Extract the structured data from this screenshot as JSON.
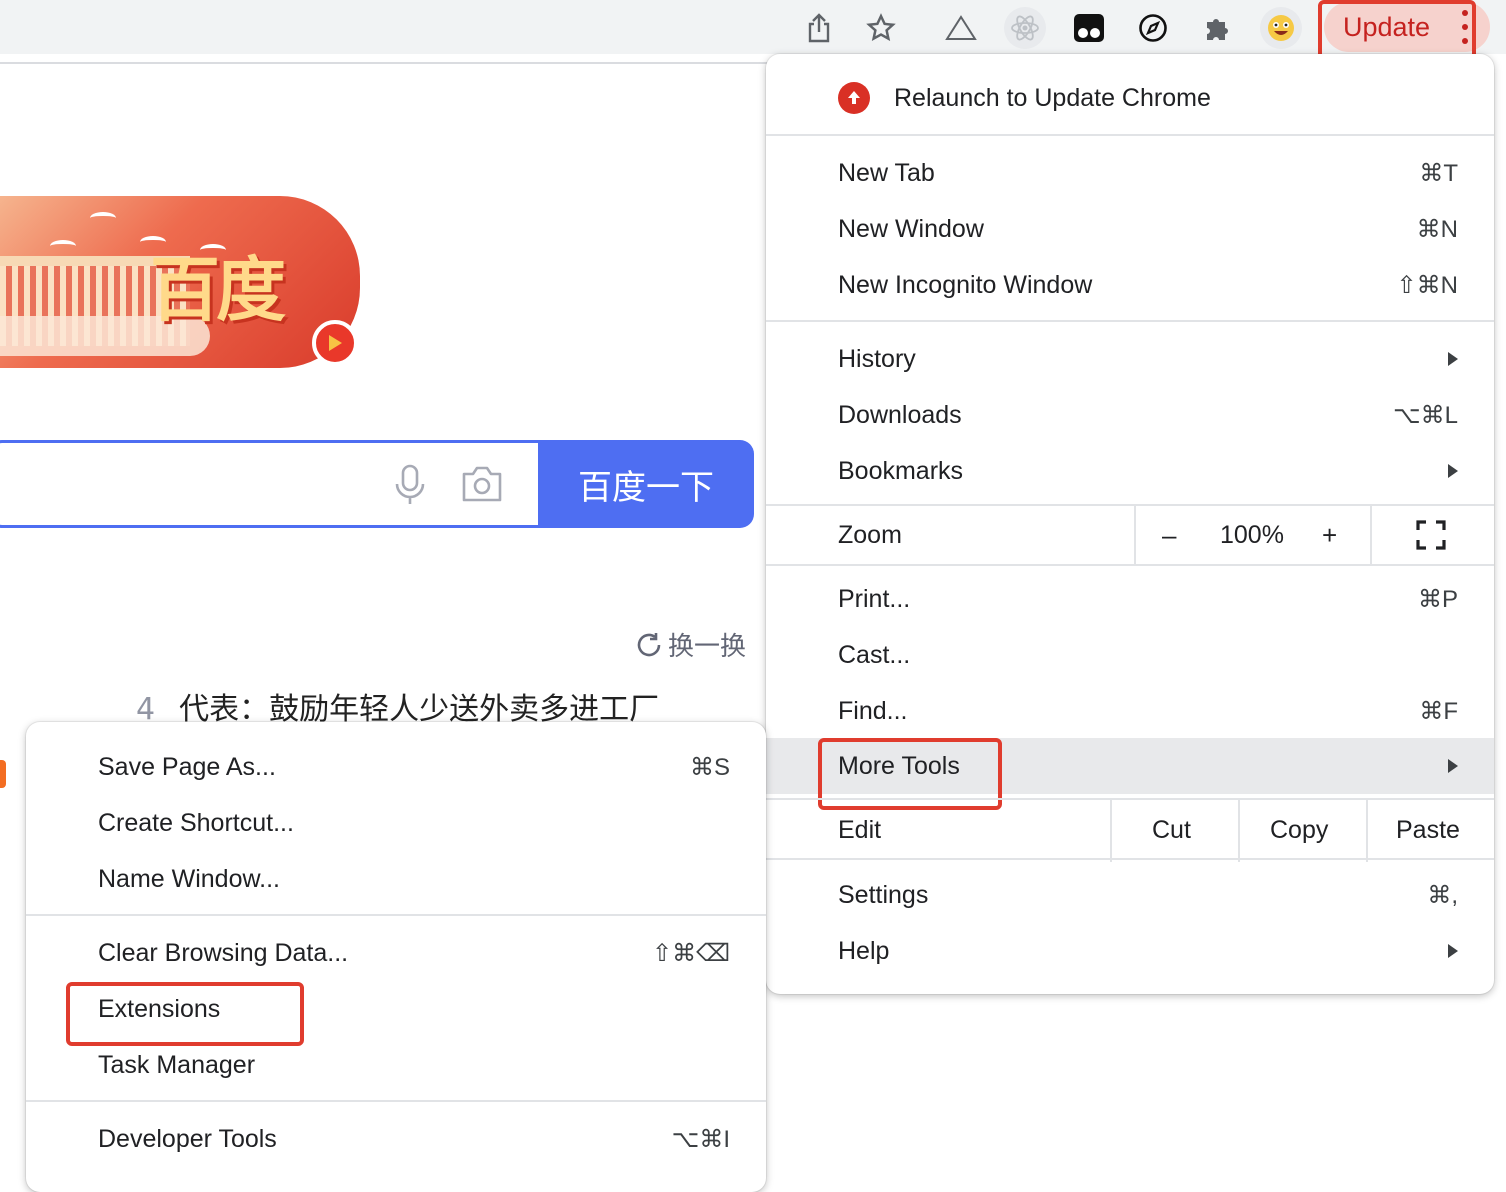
{
  "toolbar": {
    "icons": [
      "share-icon",
      "star-icon",
      "drive-icon",
      "react-devtools-icon",
      "extension-tab-icon",
      "compass-extension-icon",
      "puzzle-extensions-icon",
      "emoji-profile-icon"
    ],
    "update_label": "Update",
    "colors": {
      "update_bg": "#f6d2cd",
      "update_text": "#c5221f",
      "highlight": "#e03c2e"
    }
  },
  "page": {
    "doodle_text": "百度",
    "search_button": "百度一下",
    "refresh_link": "换一换",
    "hot_item": {
      "rank": "4",
      "text": "代表：鼓励年轻人少送外卖多进工厂"
    }
  },
  "main_menu": {
    "relaunch": "Relaunch to Update Chrome",
    "items": {
      "new_tab": {
        "label": "New Tab",
        "shortcut": "⌘T"
      },
      "new_window": {
        "label": "New Window",
        "shortcut": "⌘N"
      },
      "incognito": {
        "label": "New Incognito Window",
        "shortcut": "⇧⌘N"
      },
      "history": {
        "label": "History"
      },
      "downloads": {
        "label": "Downloads",
        "shortcut": "⌥⌘L"
      },
      "bookmarks": {
        "label": "Bookmarks"
      },
      "print": {
        "label": "Print...",
        "shortcut": "⌘P"
      },
      "cast": {
        "label": "Cast..."
      },
      "find": {
        "label": "Find...",
        "shortcut": "⌘F"
      },
      "more_tools": {
        "label": "More Tools"
      },
      "settings": {
        "label": "Settings",
        "shortcut": "⌘,"
      },
      "help": {
        "label": "Help"
      }
    },
    "zoom": {
      "label": "Zoom",
      "minus": "–",
      "value": "100%",
      "plus": "+"
    },
    "edit": {
      "label": "Edit",
      "cut": "Cut",
      "copy": "Copy",
      "paste": "Paste"
    }
  },
  "sub_menu": {
    "save_page": {
      "label": "Save Page As...",
      "shortcut": "⌘S"
    },
    "create_shortcut": {
      "label": "Create Shortcut..."
    },
    "name_window": {
      "label": "Name Window..."
    },
    "clear_data": {
      "label": "Clear Browsing Data...",
      "shortcut": "⇧⌘⌫"
    },
    "extensions": {
      "label": "Extensions"
    },
    "task_manager": {
      "label": "Task Manager"
    },
    "dev_tools": {
      "label": "Developer Tools",
      "shortcut": "⌥⌘I"
    }
  }
}
